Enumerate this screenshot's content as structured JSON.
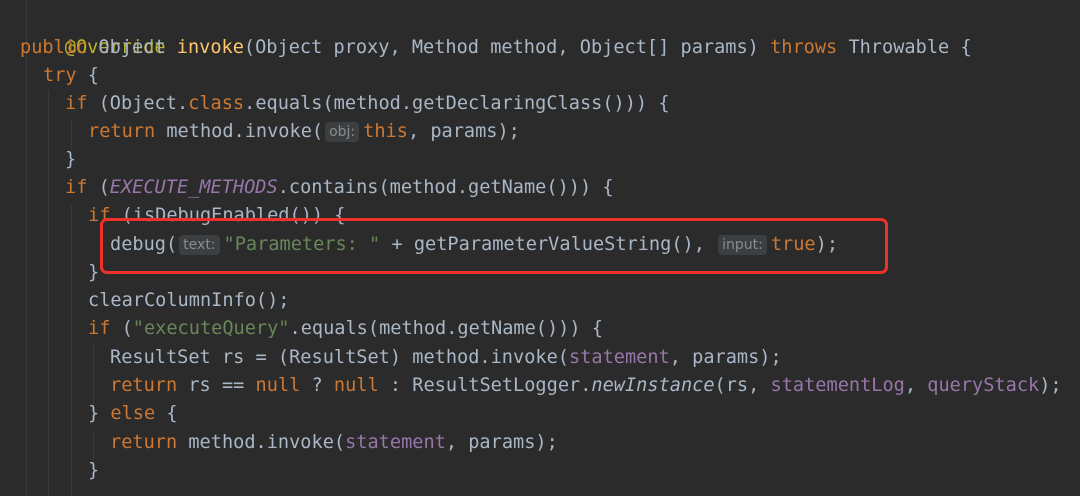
{
  "editor": {
    "annotation": "@Override",
    "signature": {
      "kw_public": "public",
      "ret_type": "Object",
      "method_name": "invoke",
      "params": "(Object proxy, Method method, Object[] params)",
      "kw_throws": "throws",
      "exception": "Throwable {"
    },
    "try_line": {
      "kw": "try",
      "rest": " {"
    },
    "if1": {
      "kw": "if",
      "pre": " (Object.",
      "kw_class": "class",
      "post": ".equals(method.getDeclaringClass())) {"
    },
    "ret1": {
      "kw": "return",
      "pre": " method.invoke(",
      "hint": "obj:",
      "kw_this": "this",
      "post": ", params);"
    },
    "close1": "}",
    "if2": {
      "kw": "if",
      "pre": " (",
      "const": "EXECUTE_METHODS",
      "post": ".contains(method.getName())) {"
    },
    "if3": {
      "kw": "if",
      "post": " (isDebugEnabled()) {"
    },
    "debug": {
      "pre": "debug(",
      "hint_text": "text:",
      "str": "\"Parameters: \"",
      "mid": " + getParameterValueString(),",
      "hint_input": "input:",
      "kw_true": "true",
      "post": ");"
    },
    "close2": "}",
    "clear": "clearColumnInfo();",
    "if4": {
      "kw": "if",
      "pre": " (",
      "str": "\"executeQuery\"",
      "post": ".equals(method.getName())) {"
    },
    "rs_line": {
      "pre": "ResultSet rs = (ResultSet) method.invoke(",
      "field1": "statement",
      "mid": ", params);"
    },
    "ret2": {
      "kw": "return",
      "a": " rs == ",
      "kw_null1": "null",
      "b": " ? ",
      "kw_null2": "null",
      "c": " : ResultSetLogger.",
      "fn_it": "newInstance",
      "d": "(rs, ",
      "field1": "statementLog",
      "e": ", ",
      "field2": "queryStack",
      "f": ");"
    },
    "else_line": {
      "pre": "} ",
      "kw": "else",
      "post": " {"
    },
    "ret3": {
      "kw": "return",
      "pre": " method.invoke(",
      "field1": "statement",
      "post": ", params);"
    },
    "close3": "}"
  },
  "colors": {
    "background": "#2b2b2b",
    "keyword": "#cc7832",
    "annotation": "#bbb529",
    "method": "#ffc66d",
    "string": "#6a8759",
    "field": "#9876aa",
    "highlight_border": "#f0312a"
  }
}
